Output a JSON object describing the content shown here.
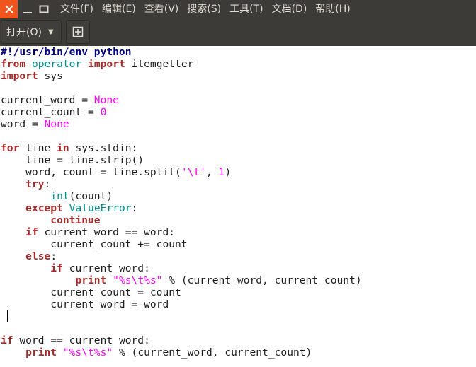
{
  "window": {
    "close_icon": "close-icon",
    "minimize_icon": "minimize-icon",
    "maximize_icon": "maximize-icon",
    "accent_close": "#f0551f",
    "chrome_bg": "#3c3b37"
  },
  "menubar": {
    "items": [
      "文件(F)",
      "编辑(E)",
      "查看(V)",
      "搜索(S)",
      "工具(T)",
      "文档(D)",
      "帮助(H)"
    ]
  },
  "toolbar": {
    "open_label": "打开(O)",
    "open_dropdown_icon": "chevron-down-icon",
    "new_tab_icon": "new-tab-icon"
  },
  "editor": {
    "lines": [
      [
        [
          "h",
          "#!/usr/bin/env python"
        ]
      ],
      [
        [
          "k",
          "from"
        ],
        [
          "t",
          " "
        ],
        [
          "b",
          "operator"
        ],
        [
          "t",
          " "
        ],
        [
          "k",
          "import"
        ],
        [
          "t",
          " itemgetter"
        ]
      ],
      [
        [
          "k",
          "import"
        ],
        [
          "t",
          " sys"
        ]
      ],
      [],
      [
        [
          "t",
          "current_word = "
        ],
        [
          "n",
          "None"
        ]
      ],
      [
        [
          "t",
          "current_count = "
        ],
        [
          "n",
          "0"
        ]
      ],
      [
        [
          "t",
          "word = "
        ],
        [
          "n",
          "None"
        ]
      ],
      [],
      [
        [
          "k",
          "for"
        ],
        [
          "t",
          " line "
        ],
        [
          "k",
          "in"
        ],
        [
          "t",
          " sys.stdin:"
        ]
      ],
      [
        [
          "t",
          "    line = line.strip()"
        ]
      ],
      [
        [
          "t",
          "    word, count = line.split("
        ],
        [
          "s",
          "'\\t'"
        ],
        [
          "t",
          ", "
        ],
        [
          "n",
          "1"
        ],
        [
          "t",
          ")"
        ]
      ],
      [
        [
          "t",
          "    "
        ],
        [
          "k",
          "try"
        ],
        [
          "t",
          ":"
        ]
      ],
      [
        [
          "t",
          "        "
        ],
        [
          "b",
          "int"
        ],
        [
          "t",
          "(count)"
        ]
      ],
      [
        [
          "t",
          "    "
        ],
        [
          "k",
          "except"
        ],
        [
          "t",
          " "
        ],
        [
          "b",
          "ValueError"
        ],
        [
          "t",
          ":"
        ]
      ],
      [
        [
          "t",
          "        "
        ],
        [
          "k",
          "continue"
        ]
      ],
      [
        [
          "t",
          "    "
        ],
        [
          "k",
          "if"
        ],
        [
          "t",
          " current_word == word:"
        ]
      ],
      [
        [
          "t",
          "        current_count += count"
        ]
      ],
      [
        [
          "t",
          "    "
        ],
        [
          "k",
          "else"
        ],
        [
          "t",
          ":"
        ]
      ],
      [
        [
          "t",
          "        "
        ],
        [
          "k",
          "if"
        ],
        [
          "t",
          " current_word:"
        ]
      ],
      [
        [
          "t",
          "            "
        ],
        [
          "k",
          "print"
        ],
        [
          "t",
          " "
        ],
        [
          "s",
          "\"%s\\t%s\""
        ],
        [
          "t",
          " % (current_word, current_count)"
        ]
      ],
      [
        [
          "t",
          "        current_count = count"
        ]
      ],
      [
        [
          "t",
          "        current_word = word"
        ]
      ],
      [],
      [],
      [
        [
          "k",
          "if"
        ],
        [
          "t",
          " word == current_word:"
        ]
      ],
      [
        [
          "t",
          "    "
        ],
        [
          "k",
          "print"
        ],
        [
          "t",
          " "
        ],
        [
          "s",
          "\"%s\\t%s\""
        ],
        [
          "t",
          " % (current_word, current_count)"
        ]
      ]
    ]
  }
}
